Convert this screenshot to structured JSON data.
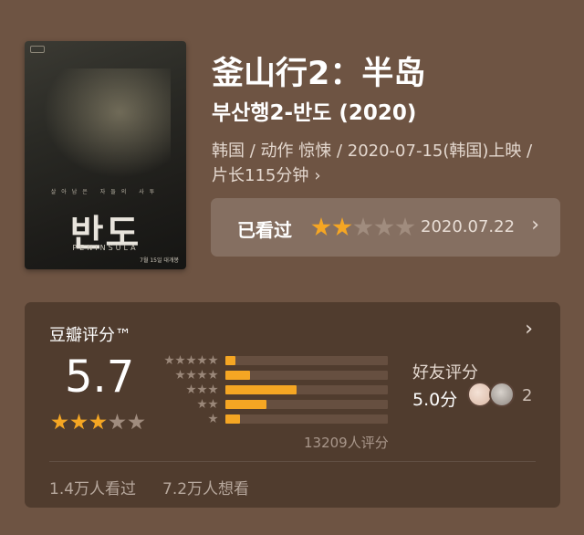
{
  "movie": {
    "title": "釜山行2：半岛",
    "original_title": "부산행2-반도 (2020)",
    "meta_line1": "韩国 / 动作 惊悚 / 2020-07-15(韩国)上映 /",
    "meta_line2": "片长115分钟",
    "meta_chevron": "›"
  },
  "poster": {
    "logo_text": "반도",
    "subtitle": "PENINSULA",
    "tagline": "살아남은 자들의 사투",
    "release": "7월 15일 대개봉"
  },
  "watched": {
    "label": "已看过",
    "user_rating": 2,
    "max_rating": 5,
    "date": "2020.07.22",
    "chevron": "›"
  },
  "rating": {
    "heading": "豆瓣评分™",
    "heading_chevron": "›",
    "score": "5.7",
    "star_rating": 3,
    "max_stars": 5,
    "distribution": [
      {
        "stars": 5,
        "fraction": 0.06
      },
      {
        "stars": 4,
        "fraction": 0.15
      },
      {
        "stars": 3,
        "fraction": 0.44
      },
      {
        "stars": 2,
        "fraction": 0.25
      },
      {
        "stars": 1,
        "fraction": 0.09
      }
    ],
    "count_text": "13209人评分",
    "friends_label": "好友评分",
    "friends_score": "5.0分",
    "friends_count": "2"
  },
  "stats": {
    "watched_text": "1.4万人看过",
    "want_text": "7.2万人想看"
  },
  "colors": {
    "background": "#6e5443",
    "accent_star": "#f5a623"
  }
}
